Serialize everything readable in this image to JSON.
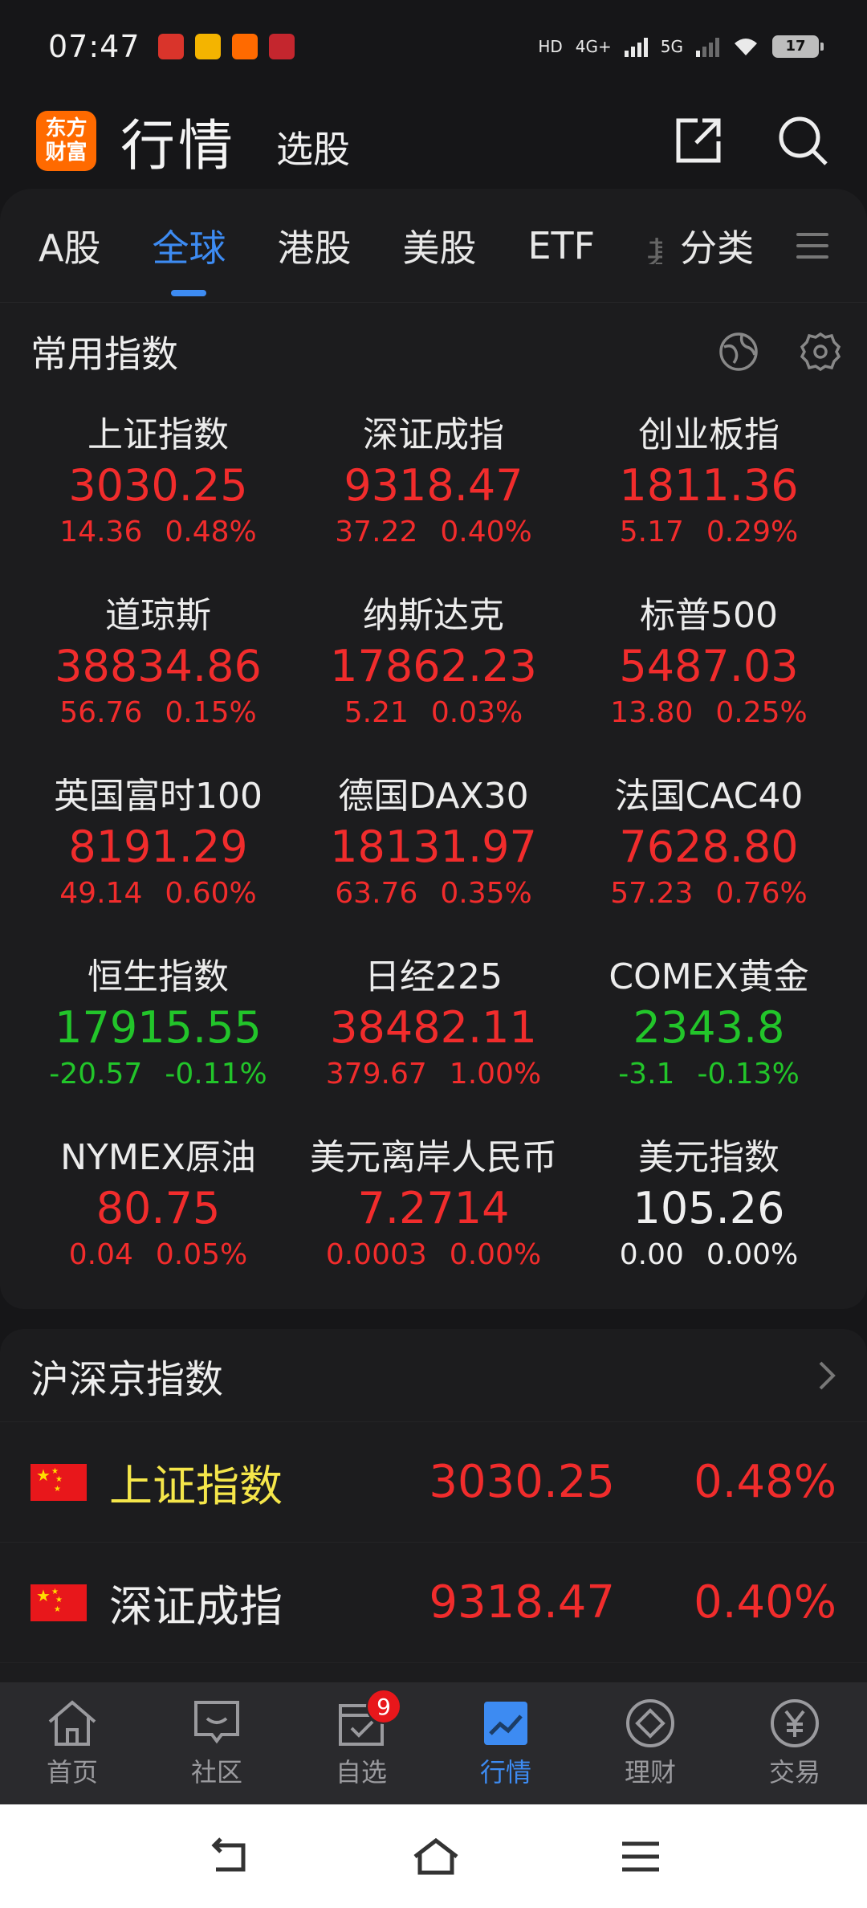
{
  "status_bar": {
    "time": "07:47",
    "notifications": [
      "头条",
      "微博",
      "飞书",
      "日历"
    ],
    "network": [
      "HD",
      "4G+",
      "5G"
    ],
    "battery": "17"
  },
  "header": {
    "logo_line1": "东方",
    "logo_line2": "财富",
    "title": "行情",
    "subtitle": "选股"
  },
  "tabs": [
    "A股",
    "全球",
    "港股",
    "美股",
    "ETF",
    "基",
    "分类"
  ],
  "active_tab": "全球",
  "section_common": {
    "title": "常用指数"
  },
  "indices": [
    {
      "name": "上证指数",
      "price": "3030.25",
      "change": "14.36",
      "percent": "0.48%",
      "trend": "up"
    },
    {
      "name": "深证成指",
      "price": "9318.47",
      "change": "37.22",
      "percent": "0.40%",
      "trend": "up"
    },
    {
      "name": "创业板指",
      "price": "1811.36",
      "change": "5.17",
      "percent": "0.29%",
      "trend": "up"
    },
    {
      "name": "道琼斯",
      "price": "38834.86",
      "change": "56.76",
      "percent": "0.15%",
      "trend": "up"
    },
    {
      "name": "纳斯达克",
      "price": "17862.23",
      "change": "5.21",
      "percent": "0.03%",
      "trend": "up"
    },
    {
      "name": "标普500",
      "price": "5487.03",
      "change": "13.80",
      "percent": "0.25%",
      "trend": "up"
    },
    {
      "name": "英国富时100",
      "price": "8191.29",
      "change": "49.14",
      "percent": "0.60%",
      "trend": "up"
    },
    {
      "name": "德国DAX30",
      "price": "18131.97",
      "change": "63.76",
      "percent": "0.35%",
      "trend": "up"
    },
    {
      "name": "法国CAC40",
      "price": "7628.80",
      "change": "57.23",
      "percent": "0.76%",
      "trend": "up"
    },
    {
      "name": "恒生指数",
      "price": "17915.55",
      "change": "-20.57",
      "percent": "-0.11%",
      "trend": "down"
    },
    {
      "name": "日经225",
      "price": "38482.11",
      "change": "379.67",
      "percent": "1.00%",
      "trend": "up"
    },
    {
      "name": "COMEX黄金",
      "price": "2343.8",
      "change": "-3.1",
      "percent": "-0.13%",
      "trend": "down"
    },
    {
      "name": "NYMEX原油",
      "price": "80.75",
      "change": "0.04",
      "percent": "0.05%",
      "trend": "up"
    },
    {
      "name": "美元离岸人民币",
      "price": "7.2714",
      "change": "0.0003",
      "percent": "0.00%",
      "trend": "up"
    },
    {
      "name": "美元指数",
      "price": "105.26",
      "change": "0.00",
      "percent": "0.00%",
      "trend": "flat"
    }
  ],
  "section_hsj": {
    "title": "沪深京指数",
    "rows": [
      {
        "name": "上证指数",
        "price": "3030.25",
        "percent": "0.48%",
        "name_color": "#f5e64a"
      },
      {
        "name": "深证成指",
        "price": "9318.47",
        "percent": "0.40%",
        "name_color": "#eeeeee"
      }
    ]
  },
  "bottom_nav": [
    {
      "label": "首页",
      "icon": "home-icon"
    },
    {
      "label": "社区",
      "icon": "community-icon"
    },
    {
      "label": "自选",
      "icon": "watchlist-icon",
      "badge": "9"
    },
    {
      "label": "行情",
      "icon": "market-icon"
    },
    {
      "label": "理财",
      "icon": "wealth-icon"
    },
    {
      "label": "交易",
      "icon": "trade-icon"
    }
  ],
  "active_nav": "行情",
  "colors": {
    "accent": "#3d8bf2",
    "up": "#f12c2c",
    "down": "#22c52a",
    "logo": "#ff6a00"
  }
}
